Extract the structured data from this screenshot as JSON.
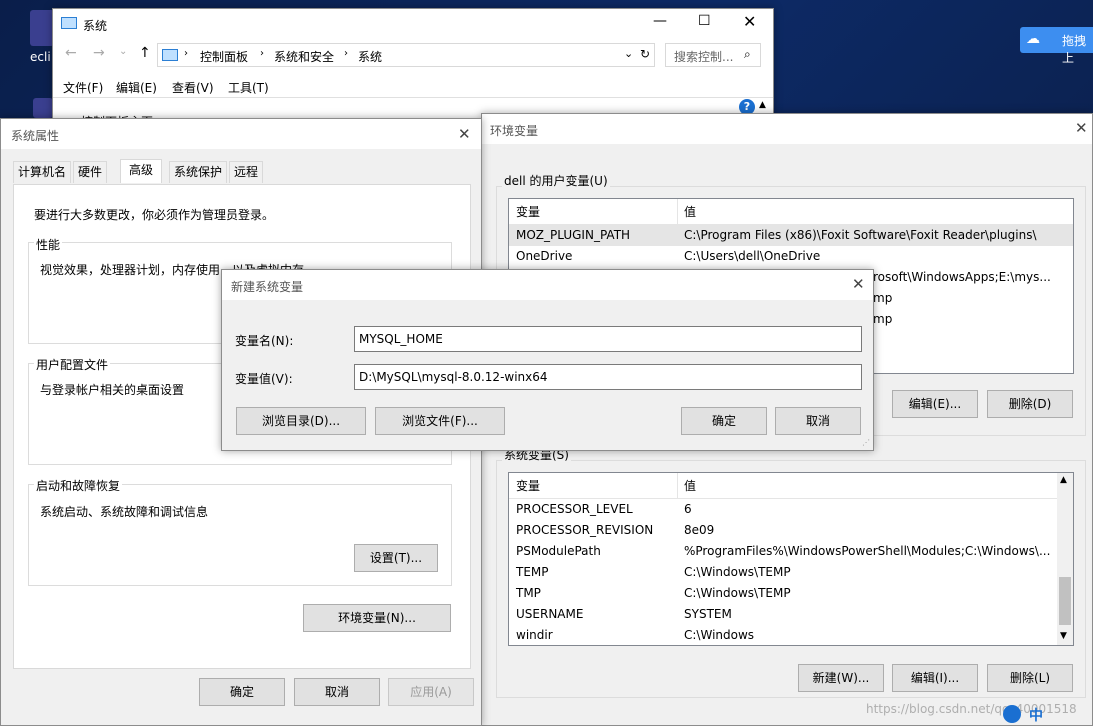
{
  "desktop": {
    "icon_label": "ecli",
    "baidu_label": "拖拽上"
  },
  "system_window": {
    "title": "系统",
    "breadcrumb": [
      "控制面板",
      "系统和安全",
      "系统"
    ],
    "search_placeholder": "搜索控制...",
    "menu": [
      "文件(F)",
      "编辑(E)",
      "查看(V)",
      "工具(T)"
    ],
    "sidebar_link": "控制面板主页"
  },
  "sys_props": {
    "title": "系统属性",
    "tabs": [
      "计算机名",
      "硬件",
      "高级",
      "系统保护",
      "远程"
    ],
    "admin_note": "要进行大多数更改，你必须作为管理员登录。",
    "perf_label": "性能",
    "perf_desc": "视觉效果，处理器计划，内存使用，以及虚拟内存",
    "profile_label": "用户配置文件",
    "profile_desc": "与登录帐户相关的桌面设置",
    "startup_label": "启动和故障恢复",
    "startup_desc": "系统启动、系统故障和调试信息",
    "settings_btn": "设置(T)...",
    "env_btn": "环境变量(N)...",
    "ok": "确定",
    "cancel": "取消",
    "apply": "应用(A)"
  },
  "env_vars": {
    "title": "环境变量",
    "user_label": "dell 的用户变量(U)",
    "col_var": "变量",
    "col_val": "值",
    "user_rows": [
      {
        "name": "MOZ_PLUGIN_PATH",
        "value": "C:\\Program Files (x86)\\Foxit Software\\Foxit Reader\\plugins\\"
      },
      {
        "name": "OneDrive",
        "value": "C:\\Users\\dell\\OneDrive"
      },
      {
        "name": "",
        "value": "rosoft\\WindowsApps;E:\\mys..."
      },
      {
        "name": "",
        "value": "mp"
      },
      {
        "name": "",
        "value": "mp"
      }
    ],
    "user_edit": "编辑(E)...",
    "user_delete": "删除(D)",
    "sys_label": "系统变量(S)",
    "sys_rows": [
      {
        "name": "PROCESSOR_LEVEL",
        "value": "6"
      },
      {
        "name": "PROCESSOR_REVISION",
        "value": "8e09"
      },
      {
        "name": "PSModulePath",
        "value": "%ProgramFiles%\\WindowsPowerShell\\Modules;C:\\Windows\\..."
      },
      {
        "name": "TEMP",
        "value": "C:\\Windows\\TEMP"
      },
      {
        "name": "TMP",
        "value": "C:\\Windows\\TEMP"
      },
      {
        "name": "USERNAME",
        "value": "SYSTEM"
      },
      {
        "name": "windir",
        "value": "C:\\Windows"
      }
    ],
    "sys_new": "新建(W)...",
    "sys_edit": "编辑(I)...",
    "sys_delete": "删除(L)"
  },
  "new_var": {
    "title": "新建系统变量",
    "name_label": "变量名(N):",
    "name_value": "MYSQL_HOME",
    "value_label": "变量值(V):",
    "value_value": "D:\\MySQL\\mysql-8.0.12-winx64",
    "browse_dir": "浏览目录(D)...",
    "browse_file": "浏览文件(F)...",
    "ok": "确定",
    "cancel": "取消"
  },
  "watermark": "https://blog.csdn.net/qq_40001518",
  "ime": "中"
}
